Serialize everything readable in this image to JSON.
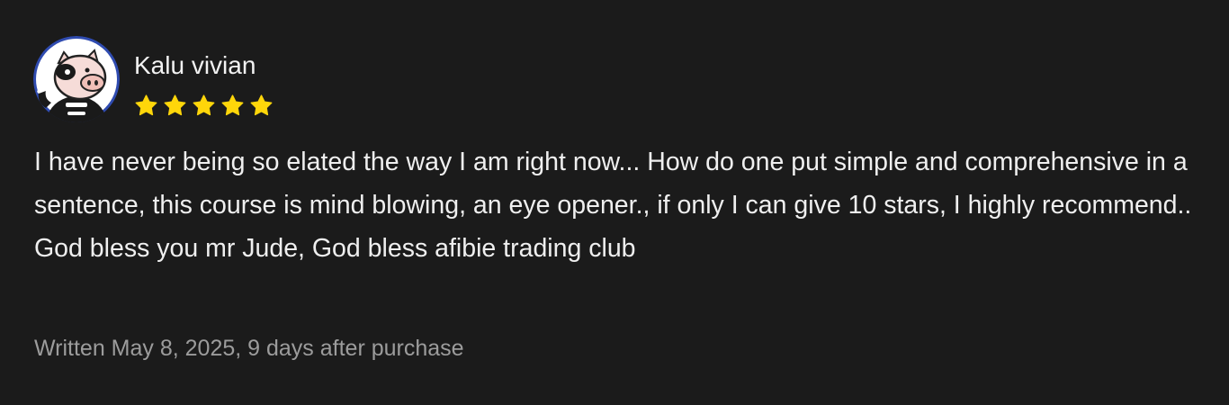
{
  "review": {
    "reviewer_name": "Kalu vivian",
    "avatar_icon": "pig-avatar-icon",
    "rating": 5,
    "rating_max": 5,
    "star_color": "#ffd60a",
    "body": "I have never being so elated the way I am right now... How do one put simple and comprehensive in a sentence, this course is mind blowing, an eye opener., if only I can give 10 stars, I highly recommend.. God bless you mr Jude, God bless afibie trading club",
    "meta": "Written May 8, 2025, 9 days after purchase"
  }
}
